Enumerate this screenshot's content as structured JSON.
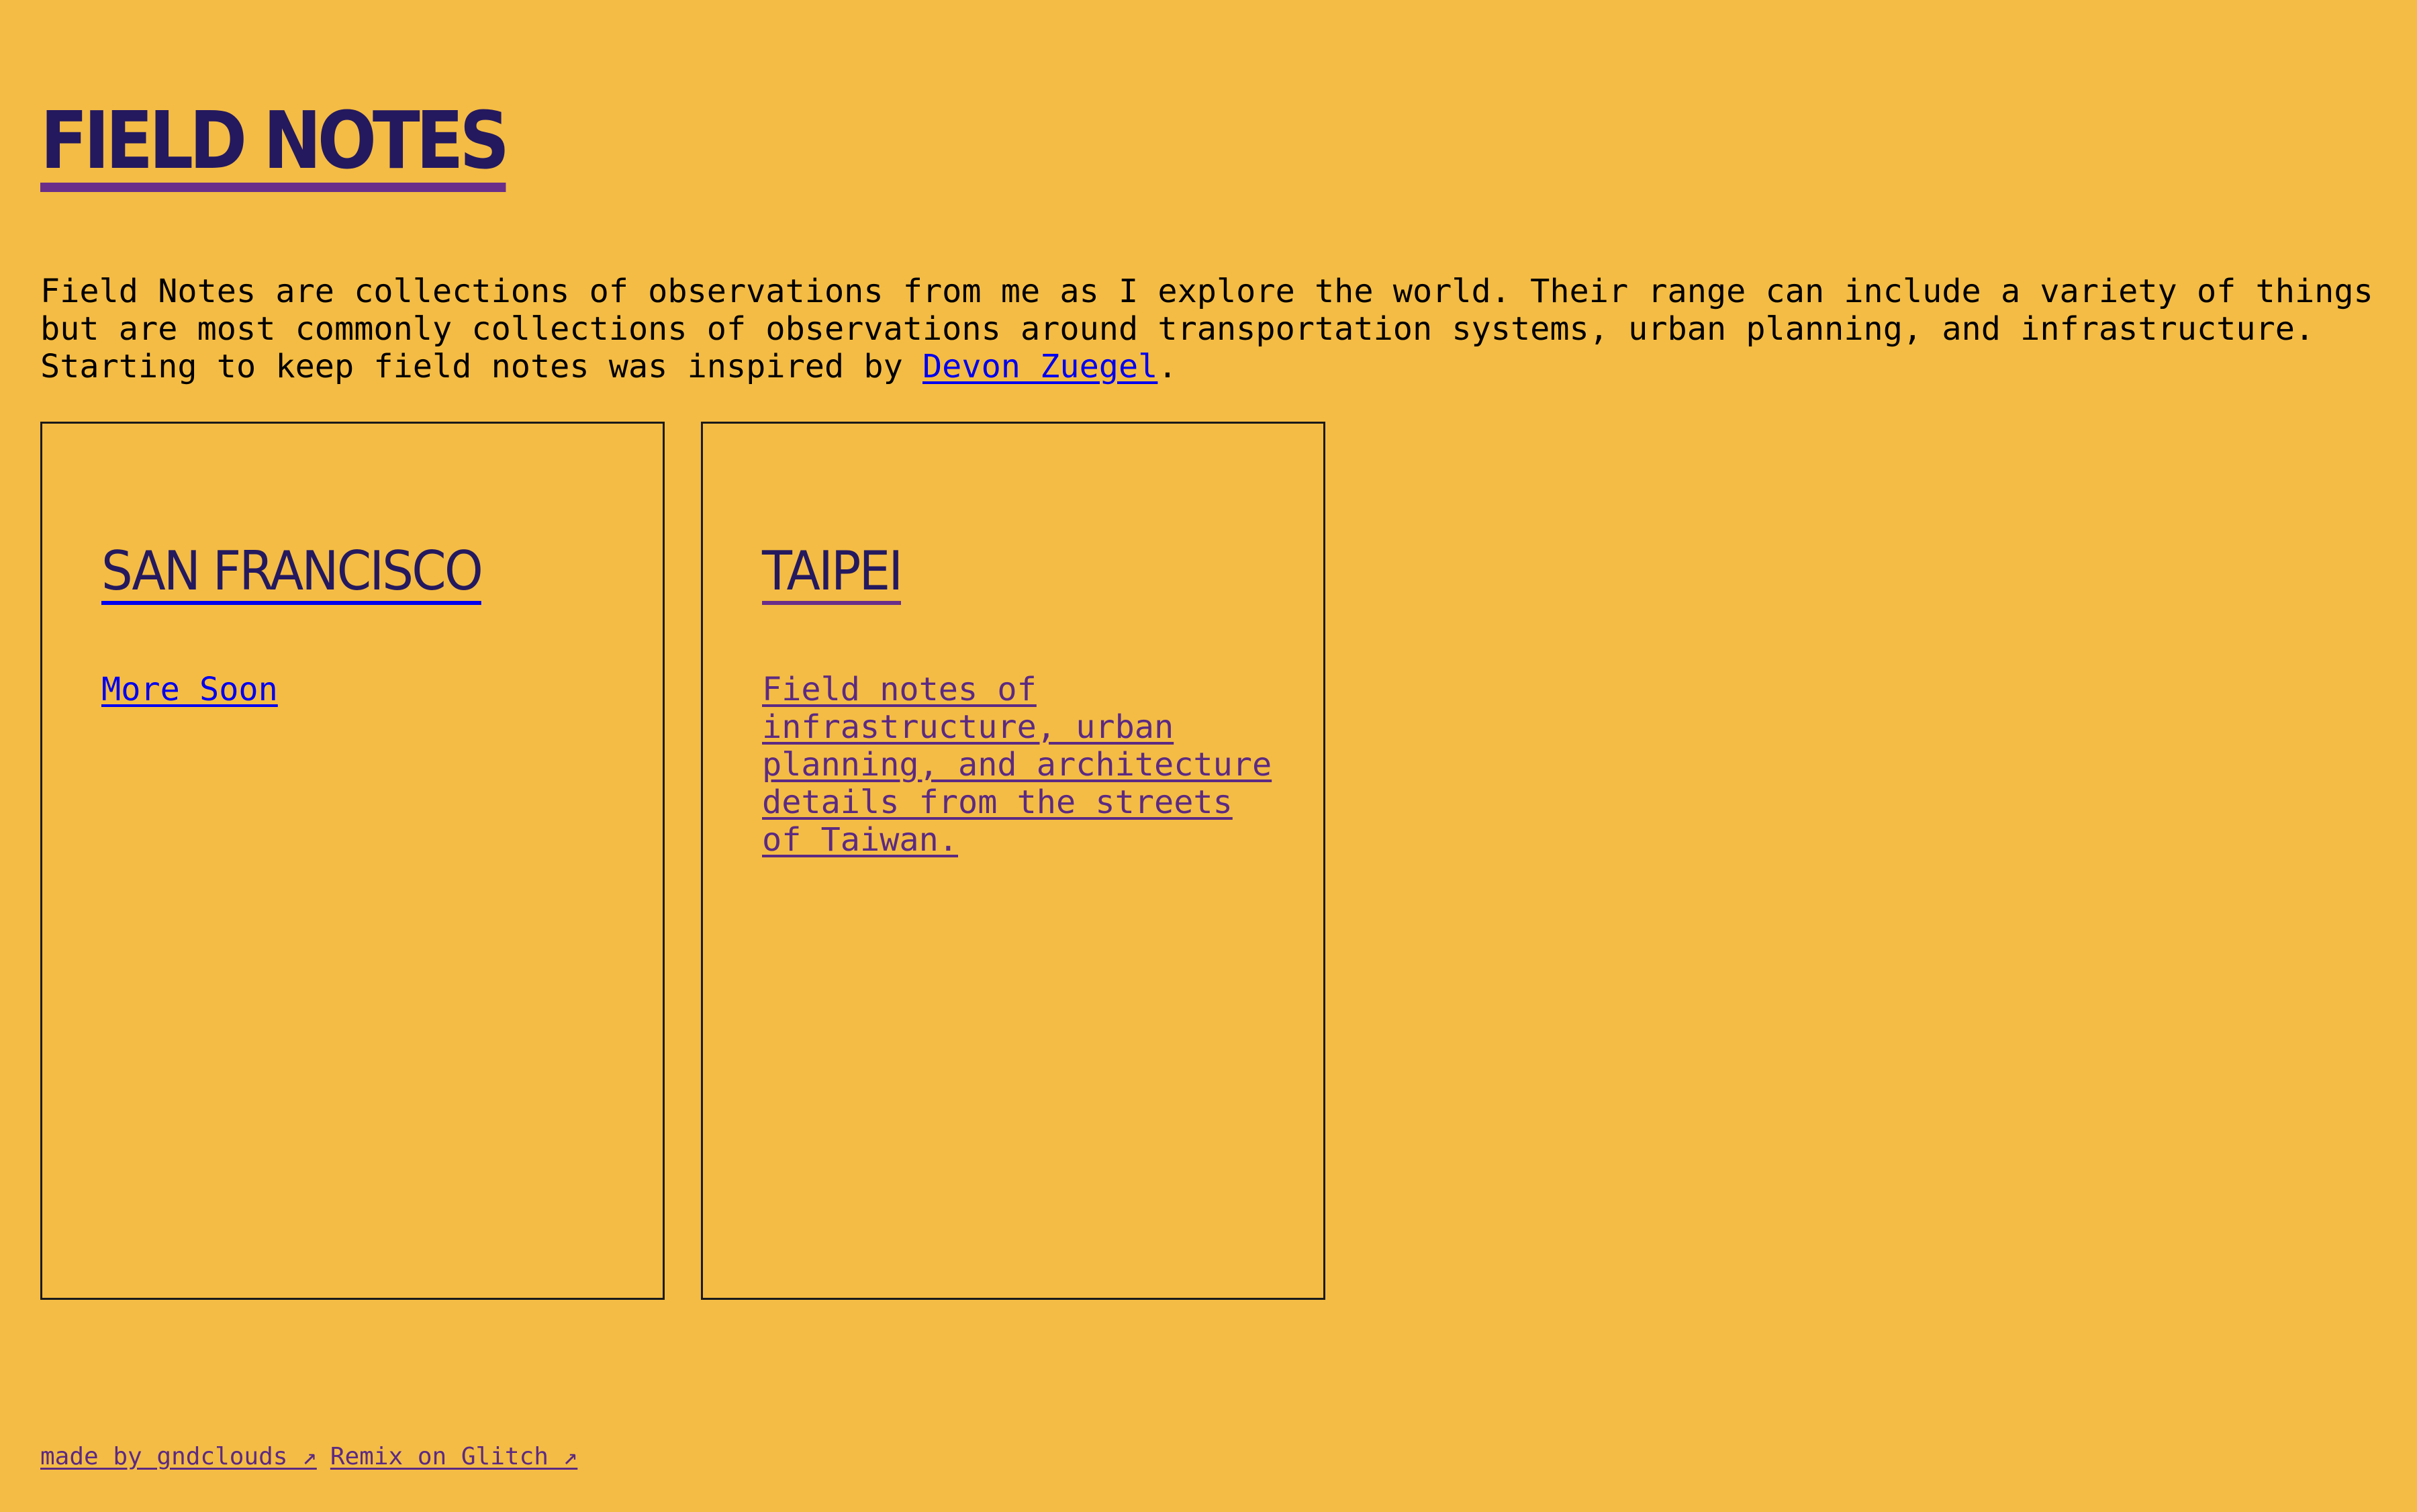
{
  "header": {
    "title": "FIELD NOTES"
  },
  "intro": {
    "line1": "Field Notes are collections of observations from me as I explore the world. Their range can include a variety of things",
    "line2": "but are most commonly collections of observations around transportation systems, urban planning, and infrastructure.",
    "line3_prefix": "Starting to keep field notes was inspired by ",
    "link_label": "Devon Zuegel",
    "line3_suffix": "."
  },
  "cards": [
    {
      "title": "SAN FRANCISCO",
      "description": "More Soon"
    },
    {
      "title": "TAIPEI",
      "description": "Field notes of infrastructure, urban planning, and architecture details from the streets of Taiwan."
    }
  ],
  "footer": {
    "made_by": "made by gndclouds ↗",
    "remix": "Remix on Glitch ↗"
  },
  "colors": {
    "background": "#f4bc44",
    "title": "#24195f",
    "link": "#0000ee",
    "visited_link": "#5c2a82",
    "title_underline": "#6a2e8a"
  }
}
